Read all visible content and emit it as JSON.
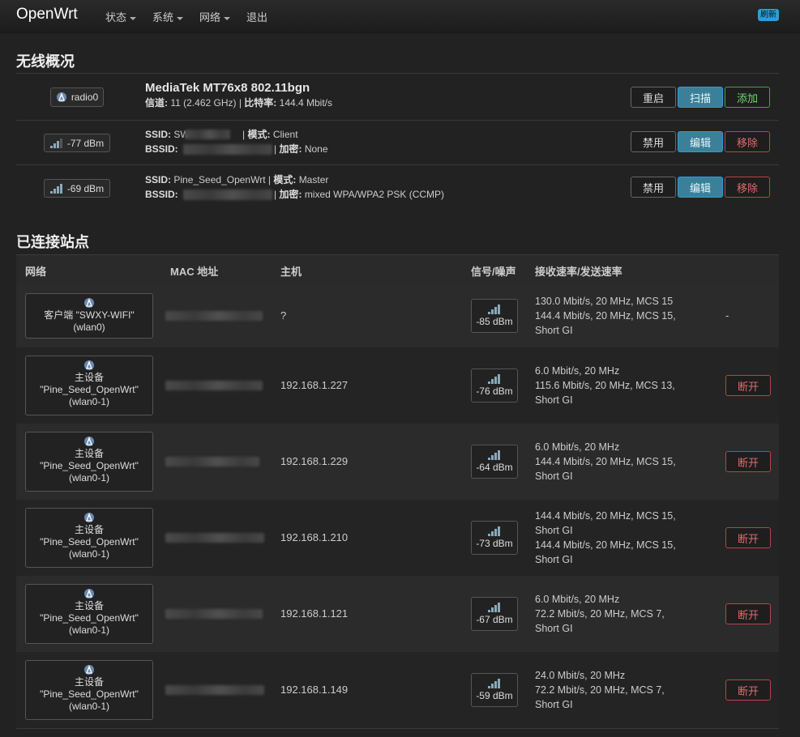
{
  "nav": {
    "brand": "OpenWrt",
    "items": [
      {
        "label": "状态",
        "dropdown": true
      },
      {
        "label": "系统",
        "dropdown": true
      },
      {
        "label": "网络",
        "dropdown": true
      },
      {
        "label": "退出",
        "dropdown": false
      }
    ],
    "refresh_badge": "刷新"
  },
  "wireless_overview": {
    "title": "无线概况",
    "radio": {
      "badge": "radio0",
      "name": "MediaTek MT76x8 802.11bgn",
      "channel_label": "信道:",
      "channel_value": "11 (2.462 GHz)",
      "bitrate_label": "比特率:",
      "bitrate_value": "144.4 Mbit/s",
      "buttons": {
        "restart": "重启",
        "scan": "扫描",
        "add": "添加"
      }
    },
    "networks": [
      {
        "signal": "-77 dBm",
        "ssid_label": "SSID:",
        "ssid_value": "SW",
        "mode_label": "模式:",
        "mode_value": "Client",
        "bssid_label": "BSSID:",
        "enc_label": "加密:",
        "enc_value": "None",
        "buttons": {
          "disable": "禁用",
          "edit": "编辑",
          "remove": "移除"
        }
      },
      {
        "signal": "-69 dBm",
        "ssid_label": "SSID:",
        "ssid_value": "Pine_Seed_OpenWrt",
        "mode_label": "模式:",
        "mode_value": "Master",
        "bssid_label": "BSSID:",
        "enc_label": "加密:",
        "enc_value": "mixed WPA/WPA2 PSK (CCMP)",
        "buttons": {
          "disable": "禁用",
          "edit": "编辑",
          "remove": "移除"
        }
      }
    ]
  },
  "stations": {
    "title": "已连接站点",
    "headers": {
      "network": "网络",
      "mac": "MAC 地址",
      "host": "主机",
      "signal": "信号/噪声",
      "rate": "接收速率/发送速率"
    },
    "rows": [
      {
        "net_lines": [
          "客户端 \"SWXY-WIFI\"",
          "(wlan0)"
        ],
        "host": "?",
        "signal": "-85 dBm",
        "rate_lines": [
          "130.0 Mbit/s, 20 MHz, MCS 15",
          "144.4 Mbit/s, 20 MHz, MCS 15,",
          "Short GI"
        ],
        "action": "-"
      },
      {
        "net_lines": [
          "主设备",
          "\"Pine_Seed_OpenWrt\"",
          "(wlan0-1)"
        ],
        "host": "192.168.1.227",
        "signal": "-76 dBm",
        "rate_lines": [
          "6.0 Mbit/s, 20 MHz",
          "115.6 Mbit/s, 20 MHz, MCS 13,",
          "Short GI"
        ],
        "action": "断开"
      },
      {
        "net_lines": [
          "主设备",
          "\"Pine_Seed_OpenWrt\"",
          "(wlan0-1)"
        ],
        "host": "192.168.1.229",
        "signal": "-64 dBm",
        "rate_lines": [
          "6.0 Mbit/s, 20 MHz",
          "144.4 Mbit/s, 20 MHz, MCS 15,",
          "Short GI"
        ],
        "action": "断开"
      },
      {
        "net_lines": [
          "主设备",
          "\"Pine_Seed_OpenWrt\"",
          "(wlan0-1)"
        ],
        "host": "192.168.1.210",
        "signal": "-73 dBm",
        "rate_lines": [
          "144.4 Mbit/s, 20 MHz, MCS 15,",
          "Short GI",
          "144.4 Mbit/s, 20 MHz, MCS 15,",
          "Short GI"
        ],
        "action": "断开"
      },
      {
        "net_lines": [
          "主设备",
          "\"Pine_Seed_OpenWrt\"",
          "(wlan0-1)"
        ],
        "host": "192.168.1.121",
        "signal": "-67 dBm",
        "rate_lines": [
          "6.0 Mbit/s, 20 MHz",
          "72.2 Mbit/s, 20 MHz, MCS 7,",
          "Short GI"
        ],
        "action": "断开"
      },
      {
        "net_lines": [
          "主设备",
          "\"Pine_Seed_OpenWrt\"",
          "(wlan0-1)"
        ],
        "host": "192.168.1.149",
        "signal": "-59 dBm",
        "rate_lines": [
          "24.0 Mbit/s, 20 MHz",
          "72.2 Mbit/s, 20 MHz, MCS 7,",
          "Short GI"
        ],
        "action": "断开"
      }
    ]
  },
  "colors": {
    "accent": "#2a9fd6",
    "danger": "#e26a6a",
    "success": "#6fd66f",
    "background": "#222222"
  }
}
